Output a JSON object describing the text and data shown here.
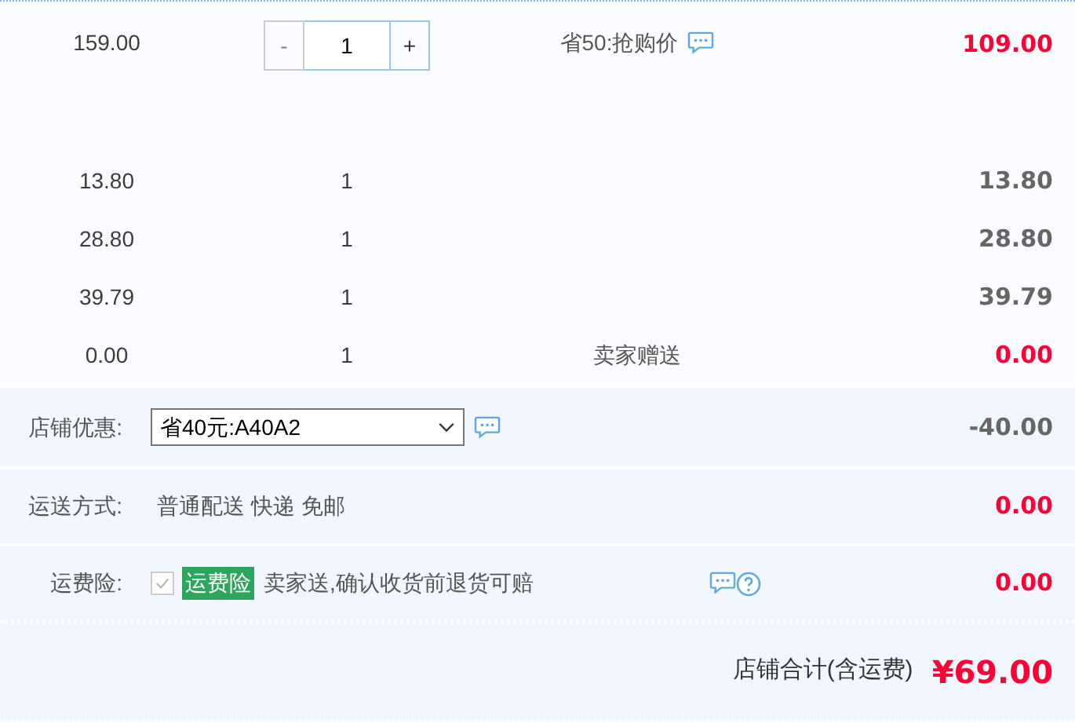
{
  "items": [
    {
      "kind": "stepper",
      "price": "159.00",
      "quantity": "1",
      "minus": "-",
      "plus": "+",
      "minus_disabled": true,
      "promo": "省50:抢购价",
      "promo_note": true,
      "total": "109.00",
      "highlight": true
    },
    {
      "kind": "plain",
      "price": "13.80",
      "quantity": "1",
      "total": "13.80",
      "highlight": false
    },
    {
      "kind": "plain",
      "price": "28.80",
      "quantity": "1",
      "total": "28.80",
      "highlight": false
    },
    {
      "kind": "plain",
      "price": "39.79",
      "quantity": "1",
      "total": "39.79",
      "highlight": false
    },
    {
      "kind": "plain",
      "price": "0.00",
      "quantity": "1",
      "promo": "卖家赠送",
      "total": "0.00",
      "highlight": true
    }
  ],
  "summary": [
    {
      "kind": "select",
      "label": "店铺优惠:",
      "value": "省40元:A40A2",
      "amount": "-40.00",
      "highlight": false
    },
    {
      "kind": "text",
      "label": "运送方式:",
      "options": [
        "普通配送",
        "快递",
        "免邮"
      ],
      "amount": "0.00",
      "highlight": true
    },
    {
      "kind": "insurance",
      "label": "运费险:",
      "checked": true,
      "disabled": true,
      "tag": "运费险",
      "text": "卖家送,确认收货前退货可赔",
      "amount": "0.00",
      "highlight": true
    }
  ],
  "total": {
    "label": "店铺合计(含运费)",
    "amount": "¥69.00"
  }
}
